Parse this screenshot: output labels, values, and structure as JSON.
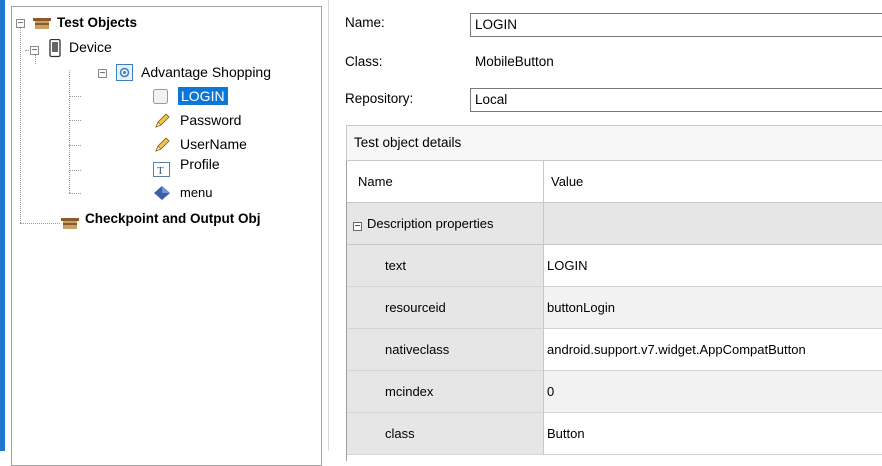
{
  "tree": {
    "root": {
      "label": "Test Objects"
    },
    "device": {
      "label": "Device"
    },
    "app": {
      "label": "Advantage Shopping"
    },
    "children": [
      {
        "label": "LOGIN",
        "icon": "button-icon",
        "selected": true
      },
      {
        "label": "Password",
        "icon": "pencil-icon"
      },
      {
        "label": "UserName",
        "icon": "pencil-icon"
      },
      {
        "label": "Profile",
        "icon": "textbox-icon"
      },
      {
        "label": "menu",
        "icon": "diamond-object-icon"
      }
    ],
    "checkpoints": {
      "label": "Checkpoint and Output Obj"
    }
  },
  "details": {
    "name_label": "Name:",
    "name_value": "LOGIN",
    "class_label": "Class:",
    "class_value": "MobileButton",
    "repository_label": "Repository:",
    "repository_value": "Local",
    "section_title": "Test object details"
  },
  "grid": {
    "col_name": "Name",
    "col_value": "Value",
    "section": "Description properties",
    "rows": [
      {
        "name": "text",
        "value": "LOGIN"
      },
      {
        "name": "resourceid",
        "value": "buttonLogin"
      },
      {
        "name": "nativeclass",
        "value": "android.support.v7.widget.AppCompatButton"
      },
      {
        "name": "mcindex",
        "value": "0"
      },
      {
        "name": "class",
        "value": "Button"
      }
    ]
  },
  "colors": {
    "selection": "#0b78d7",
    "frame_accent": "#1e78d2"
  }
}
